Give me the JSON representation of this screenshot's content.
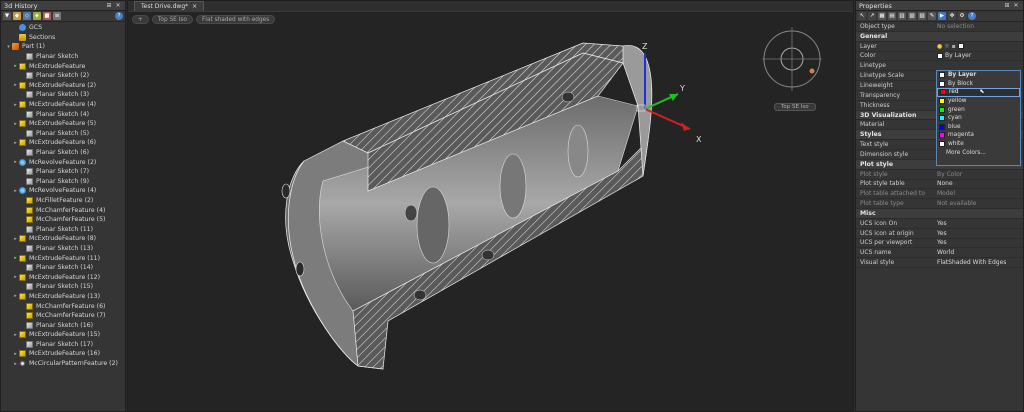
{
  "history": {
    "title": "3d History",
    "items": [
      {
        "label": "GCS",
        "icon": "gcs",
        "toggle": "",
        "indent": 1
      },
      {
        "label": "Sections",
        "icon": "folder",
        "toggle": "",
        "indent": 1
      },
      {
        "label": "Part (1)",
        "icon": "part",
        "toggle": "▾",
        "indent": 0
      },
      {
        "label": "Planar Sketch",
        "icon": "sketch",
        "toggle": "",
        "indent": 2
      },
      {
        "label": "McExtrudeFeature",
        "icon": "feat",
        "toggle": "▸",
        "indent": 1
      },
      {
        "label": "Planar Sketch (2)",
        "icon": "sketch",
        "toggle": "",
        "indent": 2
      },
      {
        "label": "McExtrudeFeature (2)",
        "icon": "feat",
        "toggle": "▸",
        "indent": 1
      },
      {
        "label": "Planar Sketch (3)",
        "icon": "sketch",
        "toggle": "",
        "indent": 2
      },
      {
        "label": "McExtrudeFeature (4)",
        "icon": "feat",
        "toggle": "▸",
        "indent": 1
      },
      {
        "label": "Planar Sketch (4)",
        "icon": "sketch",
        "toggle": "",
        "indent": 2
      },
      {
        "label": "McExtrudeFeature (5)",
        "icon": "feat",
        "toggle": "▸",
        "indent": 1
      },
      {
        "label": "Planar Sketch (5)",
        "icon": "sketch",
        "toggle": "",
        "indent": 2
      },
      {
        "label": "McExtrudeFeature (6)",
        "icon": "feat",
        "toggle": "▸",
        "indent": 1
      },
      {
        "label": "Planar Sketch (6)",
        "icon": "sketch",
        "toggle": "",
        "indent": 2
      },
      {
        "label": "McRevolveFeature (2)",
        "icon": "revolve",
        "toggle": "▸",
        "indent": 1
      },
      {
        "label": "Planar Sketch (7)",
        "icon": "sketch",
        "toggle": "",
        "indent": 2
      },
      {
        "label": "Planar Sketch (9)",
        "icon": "sketch",
        "toggle": "",
        "indent": 2
      },
      {
        "label": "McRevolveFeature (4)",
        "icon": "revolve",
        "toggle": "▸",
        "indent": 1
      },
      {
        "label": "McFilletFeature (2)",
        "icon": "feat",
        "toggle": "",
        "indent": 2
      },
      {
        "label": "McChamferFeature (4)",
        "icon": "feat",
        "toggle": "",
        "indent": 2
      },
      {
        "label": "McChamferFeature (5)",
        "icon": "feat",
        "toggle": "",
        "indent": 2
      },
      {
        "label": "Planar Sketch (11)",
        "icon": "sketch",
        "toggle": "",
        "indent": 2
      },
      {
        "label": "McExtrudeFeature (8)",
        "icon": "feat",
        "toggle": "▸",
        "indent": 1
      },
      {
        "label": "Planar Sketch (13)",
        "icon": "sketch",
        "toggle": "",
        "indent": 2
      },
      {
        "label": "McExtrudeFeature (11)",
        "icon": "feat",
        "toggle": "▸",
        "indent": 1
      },
      {
        "label": "Planar Sketch (14)",
        "icon": "sketch",
        "toggle": "",
        "indent": 2
      },
      {
        "label": "McExtrudeFeature (12)",
        "icon": "feat",
        "toggle": "▸",
        "indent": 1
      },
      {
        "label": "Planar Sketch (15)",
        "icon": "sketch",
        "toggle": "",
        "indent": 2
      },
      {
        "label": "McExtrudeFeature (13)",
        "icon": "feat",
        "toggle": "▸",
        "indent": 1
      },
      {
        "label": "McChamferFeature (6)",
        "icon": "feat",
        "toggle": "",
        "indent": 2
      },
      {
        "label": "McChamferFeature (7)",
        "icon": "feat",
        "toggle": "",
        "indent": 2
      },
      {
        "label": "Planar Sketch (16)",
        "icon": "sketch",
        "toggle": "",
        "indent": 2
      },
      {
        "label": "McExtrudeFeature (15)",
        "icon": "feat",
        "toggle": "▸",
        "indent": 1
      },
      {
        "label": "Planar Sketch (17)",
        "icon": "sketch",
        "toggle": "",
        "indent": 2
      },
      {
        "label": "McExtrudeFeature (16)",
        "icon": "feat",
        "toggle": "▸",
        "indent": 1
      },
      {
        "label": "McCircularPatternFeature (2)",
        "icon": "pattern",
        "toggle": "▸",
        "indent": 1
      }
    ]
  },
  "viewport": {
    "tab_label": "Test Drive.dwg*",
    "tab_close": "×",
    "crumbs": [
      "+",
      "Top SE Iso",
      "Flat shaded with edges"
    ],
    "axis": {
      "x": "X",
      "y": "Y",
      "z": "Z"
    },
    "navcube_label": "Top SE Iso"
  },
  "properties": {
    "title": "Properties",
    "object_type_label": "Object type",
    "object_type_value": "No selection",
    "sections": {
      "general": "General",
      "viz": "3D Visualization",
      "styles": "Styles",
      "plot": "Plot style",
      "misc": "Misc"
    },
    "general": [
      {
        "key": "Layer",
        "value": ""
      },
      {
        "key": "Color",
        "value": "By Layer"
      },
      {
        "key": "Linetype",
        "value": ""
      },
      {
        "key": "Linetype Scale",
        "value": ""
      },
      {
        "key": "Lineweight",
        "value": ""
      },
      {
        "key": "Transparency",
        "value": ""
      },
      {
        "key": "Thickness",
        "value": ""
      }
    ],
    "viz": [
      {
        "key": "Material",
        "value": ""
      }
    ],
    "styles": [
      {
        "key": "Text style",
        "value": "Standard"
      },
      {
        "key": "Dimension style",
        "value": "Standard"
      }
    ],
    "plot": [
      {
        "key": "Plot style",
        "value": "By Color",
        "dim": true
      },
      {
        "key": "Plot style table",
        "value": "None",
        "dim": false
      },
      {
        "key": "Plot table attached to",
        "value": "Model",
        "dim": true
      },
      {
        "key": "Plot table type",
        "value": "Not available",
        "dim": true
      }
    ],
    "misc": [
      {
        "key": "UCS icon On",
        "value": "Yes"
      },
      {
        "key": "UCS icon at origin",
        "value": "Yes"
      },
      {
        "key": "UCS per viewport",
        "value": "Yes"
      },
      {
        "key": "UCS name",
        "value": "World"
      },
      {
        "key": "Visual style",
        "value": "FlatShaded With Edges"
      }
    ],
    "color_dropdown": [
      {
        "label": "By Layer",
        "color": "#ffffff",
        "head": true
      },
      {
        "label": "By Block",
        "color": "#ffffff"
      },
      {
        "label": "red",
        "color": "#ff0000",
        "selected": true
      },
      {
        "label": "yellow",
        "color": "#ffff00"
      },
      {
        "label": "green",
        "color": "#00ff00"
      },
      {
        "label": "cyan",
        "color": "#00ffff"
      },
      {
        "label": "blue",
        "color": "#0000ff"
      },
      {
        "label": "magenta",
        "color": "#ff00ff"
      },
      {
        "label": "white",
        "color": "#ffffff"
      },
      {
        "label": "More Colors...",
        "color": ""
      }
    ]
  },
  "colors": {
    "accent": "#5a86b8",
    "model_face": "#8c8c8c",
    "axis_x": "#d22020",
    "axis_y": "#20b020",
    "axis_z": "#2020d0"
  }
}
